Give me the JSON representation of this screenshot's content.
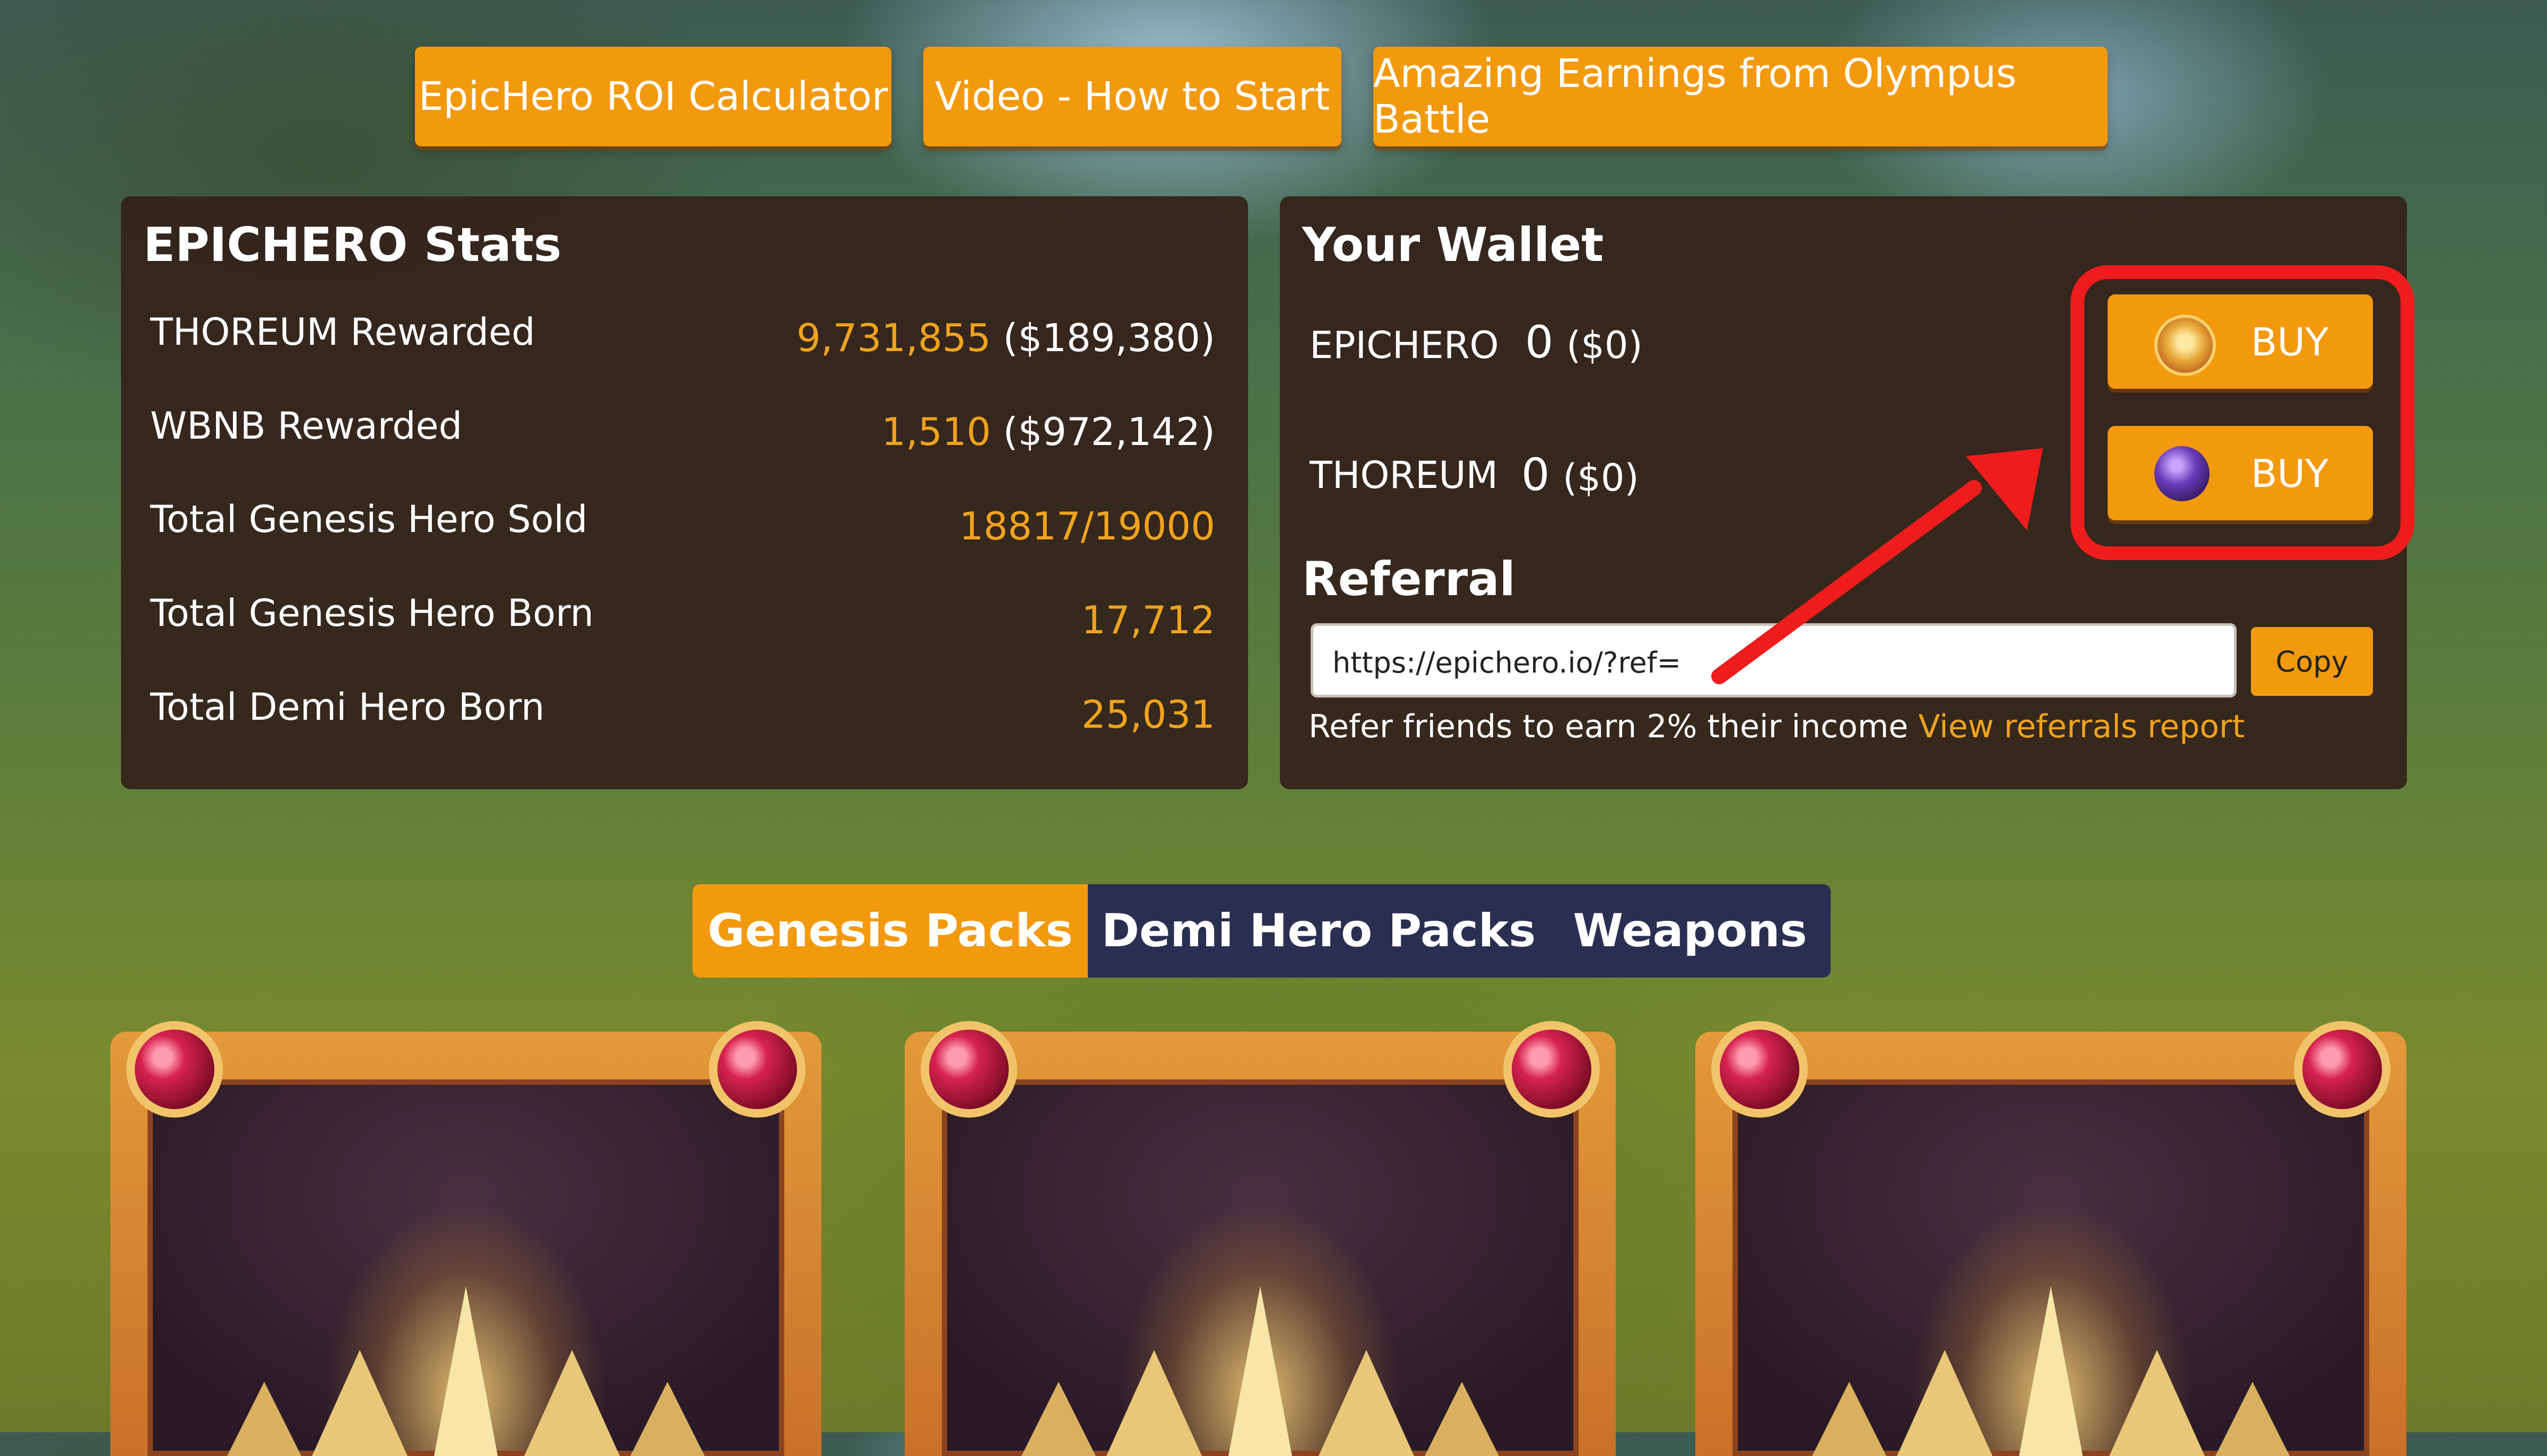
{
  "top_buttons": {
    "roi_calculator": "EpicHero ROI Calculator",
    "video_how_to_start": "Video - How to Start",
    "olympus_earnings": "Amazing Earnings from Olympus Battle"
  },
  "stats": {
    "title": "EPICHERO Stats",
    "rows": [
      {
        "label": "THOREUM Rewarded",
        "value": "9,731,855",
        "usd": "($189,380)"
      },
      {
        "label": "WBNB Rewarded",
        "value": "1,510",
        "usd": "($972,142)"
      },
      {
        "label": "Total Genesis Hero Sold",
        "value": "18817/19000",
        "usd": ""
      },
      {
        "label": "Total Genesis Hero Born",
        "value": "17,712",
        "usd": ""
      },
      {
        "label": "Total Demi Hero Born",
        "value": "25,031",
        "usd": ""
      }
    ]
  },
  "wallet": {
    "title": "Your Wallet",
    "tokens": [
      {
        "name": "EPICHERO",
        "amount": "0",
        "usd": "($0)",
        "buy_label": "BUY",
        "icon": "epichero-coin-icon"
      },
      {
        "name": "THOREUM",
        "amount": "0",
        "usd": "($0)",
        "buy_label": "BUY",
        "icon": "thoreum-coin-icon"
      }
    ]
  },
  "referral": {
    "title": "Referral",
    "link_value": "https://epichero.io/?ref=",
    "copy_label": "Copy",
    "note": "Refer friends to earn 2% their income",
    "report_link": "View referrals report"
  },
  "tabs": [
    {
      "label": "Genesis Packs",
      "active": true
    },
    {
      "label": "Demi Hero Packs",
      "active": false
    },
    {
      "label": "Weapons",
      "active": false
    }
  ],
  "colors": {
    "accent": "#f2990e",
    "panel": "#34241c",
    "highlight_annotation": "#ee1c1c",
    "value_text": "#f0a31e",
    "tab_bar": "#2a2f52"
  }
}
